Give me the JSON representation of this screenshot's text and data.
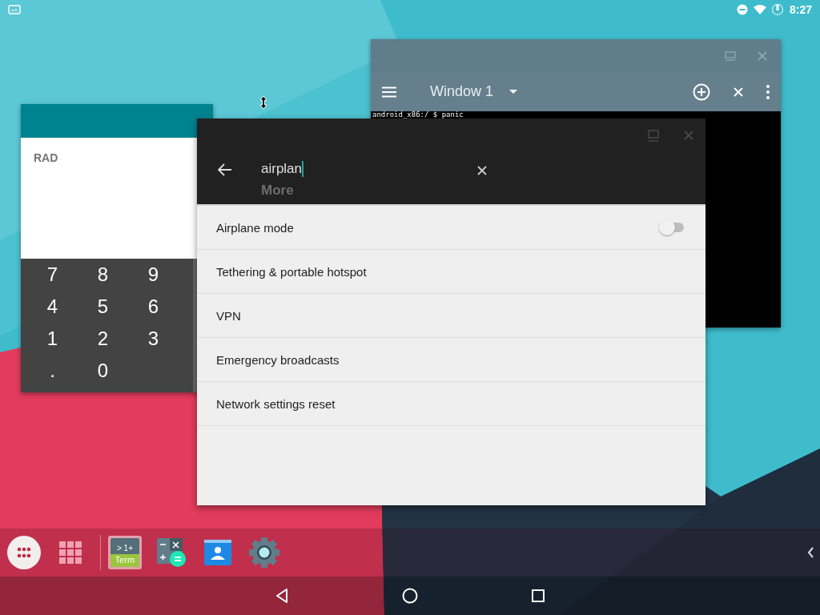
{
  "status_bar": {
    "time": "8:27"
  },
  "terminal_window": {
    "title": "Window 1",
    "lines": [
      "android_x86:/ $ panic"
    ]
  },
  "calculator_window": {
    "mode": "RAD",
    "keys": [
      "7",
      "8",
      "9",
      "4",
      "5",
      "6",
      "1",
      "2",
      "3",
      ".",
      "0"
    ]
  },
  "settings_window": {
    "search": {
      "value": "airplan"
    },
    "behind_title": "More",
    "results": [
      {
        "label": "Airplane mode",
        "kind": "toggle",
        "on": false
      },
      {
        "label": "Tethering & portable hotspot",
        "kind": "plain"
      },
      {
        "label": "VPN",
        "kind": "plain"
      },
      {
        "label": "Emergency broadcasts",
        "kind": "plain"
      },
      {
        "label": "Network settings reset",
        "kind": "plain"
      }
    ]
  },
  "taskbar": {
    "apps": [
      {
        "kind": "apps",
        "selected": false
      },
      {
        "kind": "overview",
        "selected": false
      },
      {
        "kind": "terminal",
        "selected": true,
        "label": "> 1+",
        "sublabel": "Term"
      },
      {
        "kind": "calculator",
        "selected": false
      },
      {
        "kind": "contacts",
        "selected": false
      },
      {
        "kind": "settings",
        "selected": false
      }
    ]
  }
}
